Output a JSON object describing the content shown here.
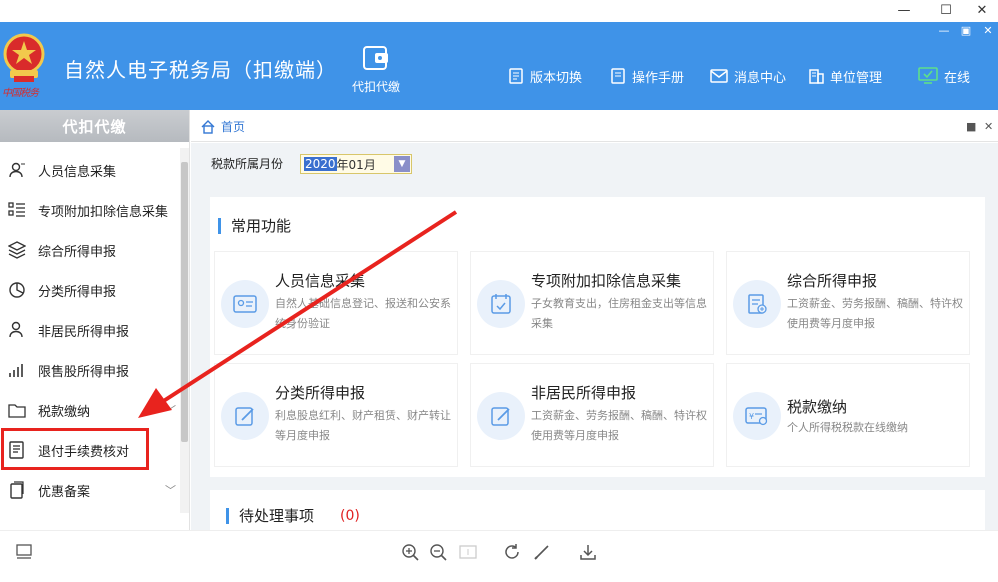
{
  "window": {
    "minimize_label": "—",
    "maximize_label": "☐",
    "close_label": "✕"
  },
  "header": {
    "emblem_caption": "中国税务",
    "title": "自然人电子税务局（扣缴端）",
    "feature_label": "代扣代缴",
    "nav": [
      {
        "label": "版本切换",
        "icon": "document-icon"
      },
      {
        "label": "操作手册",
        "icon": "manual-icon"
      },
      {
        "label": "消息中心",
        "icon": "mail-icon"
      },
      {
        "label": "单位管理",
        "icon": "building-icon"
      },
      {
        "label": "在线",
        "icon": "monitor-check-icon"
      }
    ],
    "mini_minimize": "—",
    "mini_maximize": "▣",
    "mini_close": "✕"
  },
  "sidebar": {
    "heading": "代扣代缴",
    "items": [
      {
        "label": "人员信息采集",
        "icon": "person-add-icon"
      },
      {
        "label": "专项附加扣除信息采集",
        "icon": "list-icon"
      },
      {
        "label": "综合所得申报",
        "icon": "layers-icon"
      },
      {
        "label": "分类所得申报",
        "icon": "pie-chart-icon"
      },
      {
        "label": "非居民所得申报",
        "icon": "person-icon"
      },
      {
        "label": "限售股所得申报",
        "icon": "bar-chart-icon"
      },
      {
        "label": "税款缴纳",
        "icon": "folder-icon",
        "chevron": "﹀"
      },
      {
        "label": "退付手续费核对",
        "icon": "receipt-icon"
      },
      {
        "label": "优惠备案",
        "icon": "copy-icon",
        "chevron": "﹀"
      }
    ]
  },
  "breadcrumb": {
    "home_label": "首页"
  },
  "period": {
    "label": "税款所属月份",
    "value_year": "2020",
    "value_rest": "年01月",
    "dropdown_glyph": "▼"
  },
  "common": {
    "title": "常用功能",
    "cards": [
      {
        "title": "人员信息采集",
        "desc": "自然人基础信息登记、报送和公安系统身份验证"
      },
      {
        "title": "专项附加扣除信息采集",
        "desc": "子女教育支出，住房租金支出等信息采集"
      },
      {
        "title": "综合所得申报",
        "desc": "工资薪金、劳务报酬、稿酬、特许权使用费等月度申报"
      },
      {
        "title": "分类所得申报",
        "desc": "利息股息红利、财产租赁、财产转让等月度申报"
      },
      {
        "title": "非居民所得申报",
        "desc": "工资薪金、劳务报酬、稿酬、特许权使用费等月度申报"
      },
      {
        "title": "税款缴纳",
        "desc": "个人所得税税款在线缴纳"
      }
    ]
  },
  "pending": {
    "title": "待处理事项",
    "count": "(0)"
  },
  "colors": {
    "header_blue": "#3f93e8",
    "highlight_red": "#e8231e",
    "pending_red": "#e02020"
  }
}
